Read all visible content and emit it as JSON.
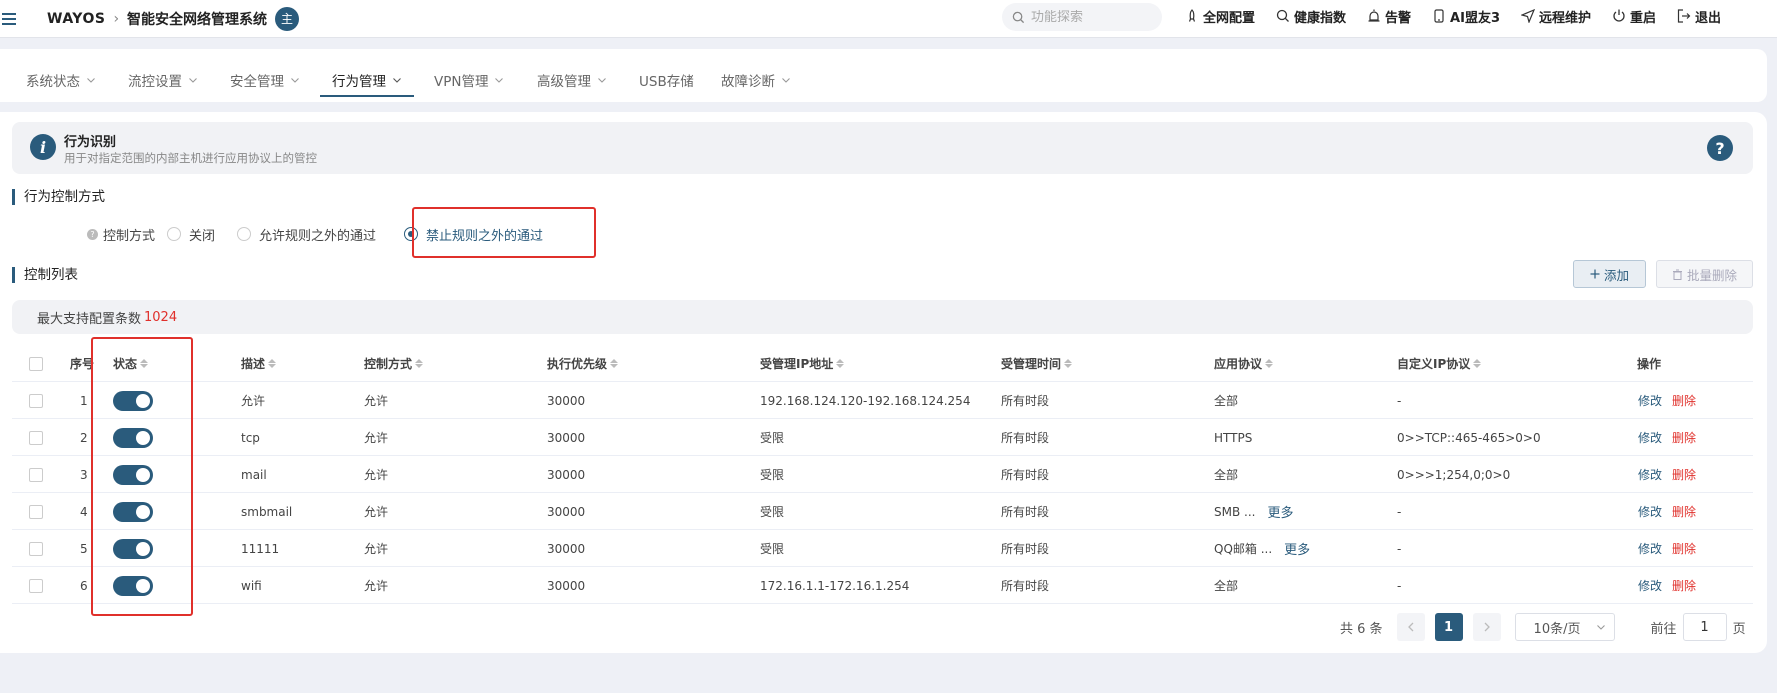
{
  "header": {
    "brand": "WAYOS",
    "system_name": "智能安全网络管理系统",
    "role_badge": "主",
    "search_placeholder": "功能探索",
    "actions": [
      {
        "label": "全网配置",
        "icon": "rocket-icon"
      },
      {
        "label": "健康指数",
        "icon": "health-icon"
      },
      {
        "label": "告警",
        "icon": "alarm-icon"
      },
      {
        "label": "AI盟友3",
        "icon": "phone-icon"
      },
      {
        "label": "远程维护",
        "icon": "send-icon"
      },
      {
        "label": "重启",
        "icon": "power-icon"
      },
      {
        "label": "退出",
        "icon": "logout-icon"
      }
    ]
  },
  "nav": {
    "tabs": [
      {
        "label": "系统状态",
        "dropdown": true
      },
      {
        "label": "流控设置",
        "dropdown": true
      },
      {
        "label": "安全管理",
        "dropdown": true
      },
      {
        "label": "行为管理",
        "dropdown": true,
        "active": true
      },
      {
        "label": "VPN管理",
        "dropdown": true
      },
      {
        "label": "高级管理",
        "dropdown": true
      },
      {
        "label": "USB存储",
        "dropdown": false
      },
      {
        "label": "故障诊断",
        "dropdown": true
      }
    ]
  },
  "info": {
    "title": "行为识别",
    "description": "用于对指定范围的内部主机进行应用协议上的管控",
    "help": "?"
  },
  "mode_section": {
    "title": "行为控制方式",
    "label": "控制方式",
    "options": [
      "关闭",
      "允许规则之外的通过",
      "禁止规则之外的通过"
    ],
    "selected": "禁止规则之外的通过"
  },
  "list_section": {
    "title": "控制列表",
    "add_label": "添加",
    "batch_delete_label": "批量删除",
    "max_label": "最大支持配置条数",
    "max_value": "1024"
  },
  "table": {
    "columns": [
      "序号",
      "状态",
      "描述",
      "控制方式",
      "执行优先级",
      "受管理IP地址",
      "受管理时间",
      "应用协议",
      "自定义IP协议",
      "操作"
    ],
    "edit_label": "修改",
    "delete_label": "删除",
    "more_label": "更多",
    "rows": [
      {
        "index": "1",
        "enabled": true,
        "desc": "允许",
        "mode": "允许",
        "priority": "30000",
        "ip": "192.168.124.120-192.168.124.254",
        "time": "所有时段",
        "app": "全部",
        "more": false,
        "custom_ip": "-"
      },
      {
        "index": "2",
        "enabled": true,
        "desc": "tcp",
        "mode": "允许",
        "priority": "30000",
        "ip": "受限",
        "time": "所有时段",
        "app": "HTTPS",
        "more": false,
        "custom_ip": "0>>TCP::465-465>0>0"
      },
      {
        "index": "3",
        "enabled": true,
        "desc": "mail",
        "mode": "允许",
        "priority": "30000",
        "ip": "受限",
        "time": "所有时段",
        "app": "全部",
        "more": false,
        "custom_ip": "0>>>1;254,0;0>0"
      },
      {
        "index": "4",
        "enabled": true,
        "desc": "smbmail",
        "mode": "允许",
        "priority": "30000",
        "ip": "受限",
        "time": "所有时段",
        "app": "SMB ...",
        "more": true,
        "custom_ip": "-"
      },
      {
        "index": "5",
        "enabled": true,
        "desc": "11111",
        "mode": "允许",
        "priority": "30000",
        "ip": "受限",
        "time": "所有时段",
        "app": "QQ邮箱 ...",
        "more": true,
        "custom_ip": "-"
      },
      {
        "index": "6",
        "enabled": true,
        "desc": "wifi",
        "mode": "允许",
        "priority": "30000",
        "ip": "172.16.1.1-172.16.1.254",
        "time": "所有时段",
        "app": "全部",
        "more": false,
        "custom_ip": "-"
      }
    ]
  },
  "pagination": {
    "total_label": "共 6 条",
    "current_page": "1",
    "page_size": "10条/页",
    "goto_label": "前往",
    "goto_value": "1",
    "page_suffix": "页"
  },
  "colors": {
    "accent": "#2a5b7c",
    "danger": "#e0302b",
    "highlight_box": "#e0302b"
  }
}
